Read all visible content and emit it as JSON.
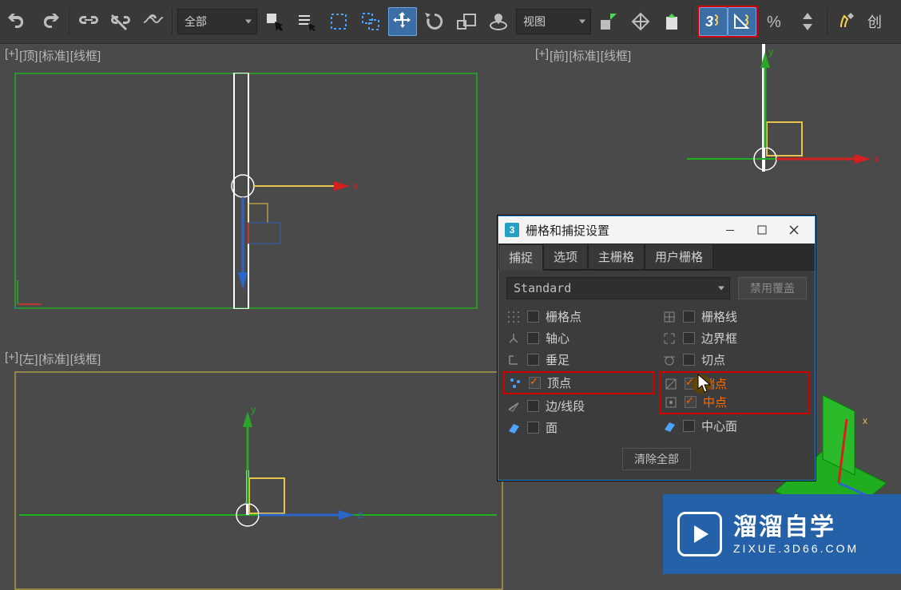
{
  "toolbar": {
    "filter_select": "全部",
    "coord_select": "视图",
    "create_label": "创"
  },
  "viewports": {
    "top": {
      "plus": "[+]",
      "name": "[顶]",
      "shade": "[标准]",
      "mode": "[线框]"
    },
    "front": {
      "plus": "[+]",
      "name": "[前]",
      "shade": "[标准]",
      "mode": "[线框]"
    },
    "left": {
      "plus": "[+]",
      "name": "[左]",
      "shade": "[标准]",
      "mode": "[线框]"
    }
  },
  "dialog": {
    "title": "栅格和捕捉设置",
    "tabs": {
      "snap": "捕捉",
      "options": "选项",
      "mainGrid": "主栅格",
      "userGrid": "用户栅格"
    },
    "select": "Standard",
    "disable": "禁用覆盖",
    "options": {
      "gridPoint": "栅格点",
      "pivot": "轴心",
      "perp": "垂足",
      "vertex": "顶点",
      "edge": "边/线段",
      "face": "面",
      "gridLine": "栅格线",
      "bounding": "边界框",
      "tangent": "切点",
      "endpoint": "端点",
      "midpoint": "中点",
      "centerFace": "中心面"
    },
    "clear": "清除全部"
  },
  "axes": {
    "x": "x",
    "y": "y",
    "z": "z"
  },
  "watermark": {
    "big": "溜溜自学",
    "small": "ZIXUE.3D66.COM"
  },
  "icons": {
    "undo": "undo",
    "redo": "redo"
  }
}
